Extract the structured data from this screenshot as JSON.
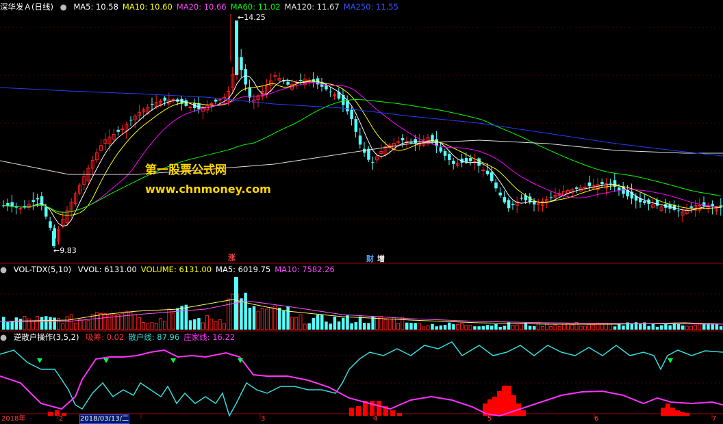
{
  "colors": {
    "ma5": "#ffffff",
    "ma10": "#ffff00",
    "ma20": "#ff00ff",
    "ma60": "#00ff00",
    "ma120": "#e0e0e0",
    "ma250": "#2040ff",
    "up": "#ff2020",
    "down": "#55ffff",
    "cyan_line": "#33dddd",
    "magenta_line": "#ff33ff",
    "red_bar": "#ff0000"
  },
  "price_panel": {
    "stock_name": "深华发Ａ(日线)",
    "ma_labels": [
      {
        "text": "MA5: 10.58",
        "color": "#ffffff"
      },
      {
        "text": "MA10: 10.60",
        "color": "#ffff00"
      },
      {
        "text": "MA20: 10.66",
        "color": "#ff44ff"
      },
      {
        "text": "MA60: 11.02",
        "color": "#00ff00"
      },
      {
        "text": "MA120: 11.67",
        "color": "#e0e0e0"
      },
      {
        "text": "MA250: 11.55",
        "color": "#3355ff"
      }
    ],
    "high_label": "14.25",
    "low_label": "9.83",
    "watermark_title": "第一股票公式网",
    "watermark_url": "www.chnmoney.com",
    "event_markers": [
      "涨",
      "财",
      "增"
    ]
  },
  "volume_panel": {
    "title": "VOL-TDX(5,10)",
    "labels": [
      {
        "text": "VVOL: 6131.00",
        "color": "#ffffff"
      },
      {
        "text": "VOLUME: 6131.00",
        "color": "#ffff00"
      },
      {
        "text": "MA5: 6019.75",
        "color": "#ffffff"
      },
      {
        "text": "MA10: 7582.26",
        "color": "#ff44ff"
      }
    ]
  },
  "indicator_panel": {
    "title": "逆散户操作(3,5,2)",
    "labels": [
      {
        "text": "吸筹: 0.02",
        "color": "#ff3030"
      },
      {
        "text": "散户线: 87.96",
        "color": "#33dddd"
      },
      {
        "text": "庄家线: 16.22",
        "color": "#ff33ff"
      }
    ]
  },
  "date_axis": {
    "labels": [
      "2018年",
      "2",
      "2018/03/13/二",
      "3",
      "4",
      "5",
      "6",
      "7"
    ]
  },
  "chart_data": {
    "type": "candlestick",
    "ylim": [
      9.6,
      14.4
    ],
    "high": 14.25,
    "low": 9.83,
    "key_closes": [
      10.3,
      10.5,
      10.2,
      9.9,
      10.6,
      11.2,
      11.8,
      12.2,
      12.4,
      12.0,
      12.6,
      13.6,
      12.9,
      12.8,
      12.7,
      12.3,
      11.8,
      11.5,
      11.0,
      11.3,
      11.6,
      11.1,
      10.8,
      10.2,
      10.5,
      10.7,
      10.8,
      10.6,
      10.5,
      10.6
    ]
  }
}
